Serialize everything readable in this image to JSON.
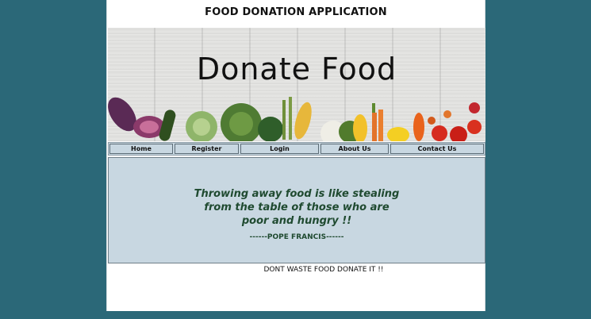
{
  "header": {
    "title": "FOOD DONATION APPLICATION"
  },
  "banner": {
    "headline": "Donate Food",
    "image_icon": "vegetables-banner-image"
  },
  "nav": {
    "items": [
      {
        "label": "Home"
      },
      {
        "label": "Register"
      },
      {
        "label": "Login"
      },
      {
        "label": "About Us"
      },
      {
        "label": "Contact Us"
      }
    ]
  },
  "quote": {
    "line1": "Throwing away food is like stealing",
    "line2": "from the table of those who are",
    "line3": "poor and hungry !!",
    "author": "------POPE FRANCIS------"
  },
  "footer": {
    "text": "DONT WASTE FOOD DONATE IT !!"
  },
  "colors": {
    "background": "#2b6878",
    "panel": "#c8d7e1",
    "quote_text": "#1f4a30"
  }
}
